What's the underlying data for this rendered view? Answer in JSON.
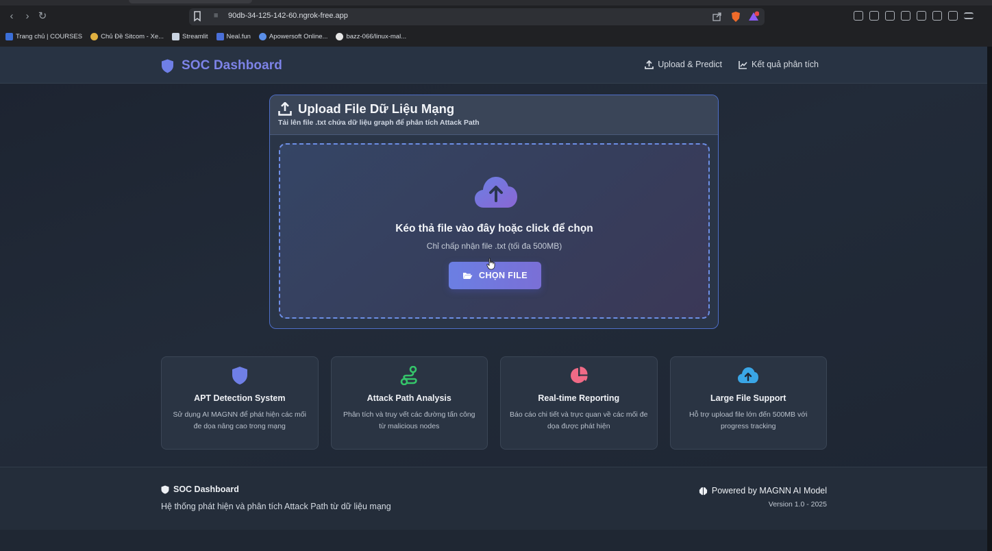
{
  "browser": {
    "url": "90db-34-125-142-60.ngrok-free.app",
    "bookmarks": [
      {
        "label": "Trang chủ | COURSES",
        "color": "#3b6fd8"
      },
      {
        "label": "Chủ Đề Sitcom - Xe...",
        "color": "#e0b040"
      },
      {
        "label": "Streamlit",
        "color": "#c9d3e0"
      },
      {
        "label": "Neal.fun",
        "color": "#4a6fd8"
      },
      {
        "label": "Apowersoft Online...",
        "color": "#5a8ee8"
      },
      {
        "label": "bazz-066/linux-mal...",
        "color": "#e6e6e6"
      }
    ]
  },
  "header": {
    "brand": "SOC Dashboard",
    "nav": [
      {
        "label": "Upload & Predict",
        "icon": "upload-icon"
      },
      {
        "label": "Kết quả phân tích",
        "icon": "chart-line-icon"
      }
    ]
  },
  "upload": {
    "title": "Upload File Dữ Liệu Mạng",
    "subtitle": "Tải lên file .txt chứa dữ liệu graph để phân tích Attack Path",
    "drop_title": "Kéo thả file vào đây hoặc click để chọn",
    "drop_hint": "Chỉ chấp nhận file .txt (tối đa 500MB)",
    "button_label": "CHỌN FILE"
  },
  "features": [
    {
      "title": "APT Detection System",
      "desc": "Sử dụng AI MAGNN để phát hiện các mối đe dọa nâng cao trong mạng",
      "icon": "shield-icon",
      "color": "#6f7fe6"
    },
    {
      "title": "Attack Path Analysis",
      "desc": "Phân tích và truy vết các đường tấn công từ malicious nodes",
      "icon": "route-icon",
      "color": "#35c46a"
    },
    {
      "title": "Real-time Reporting",
      "desc": "Báo cáo chi tiết và trực quan về các mối đe dọa được phát hiện",
      "icon": "pie-chart-icon",
      "color": "#f06a86"
    },
    {
      "title": "Large File Support",
      "desc": "Hỗ trợ upload file lớn đến 500MB với progress tracking",
      "icon": "cloud-upload-icon",
      "color": "#3aa6e6"
    }
  ],
  "footer": {
    "brand": "SOC Dashboard",
    "desc": "Hệ thống phát hiện và phân tích Attack Path từ dữ liệu mạng",
    "powered": "Powered by MAGNN AI Model",
    "version": "Version 1.0 - 2025"
  }
}
